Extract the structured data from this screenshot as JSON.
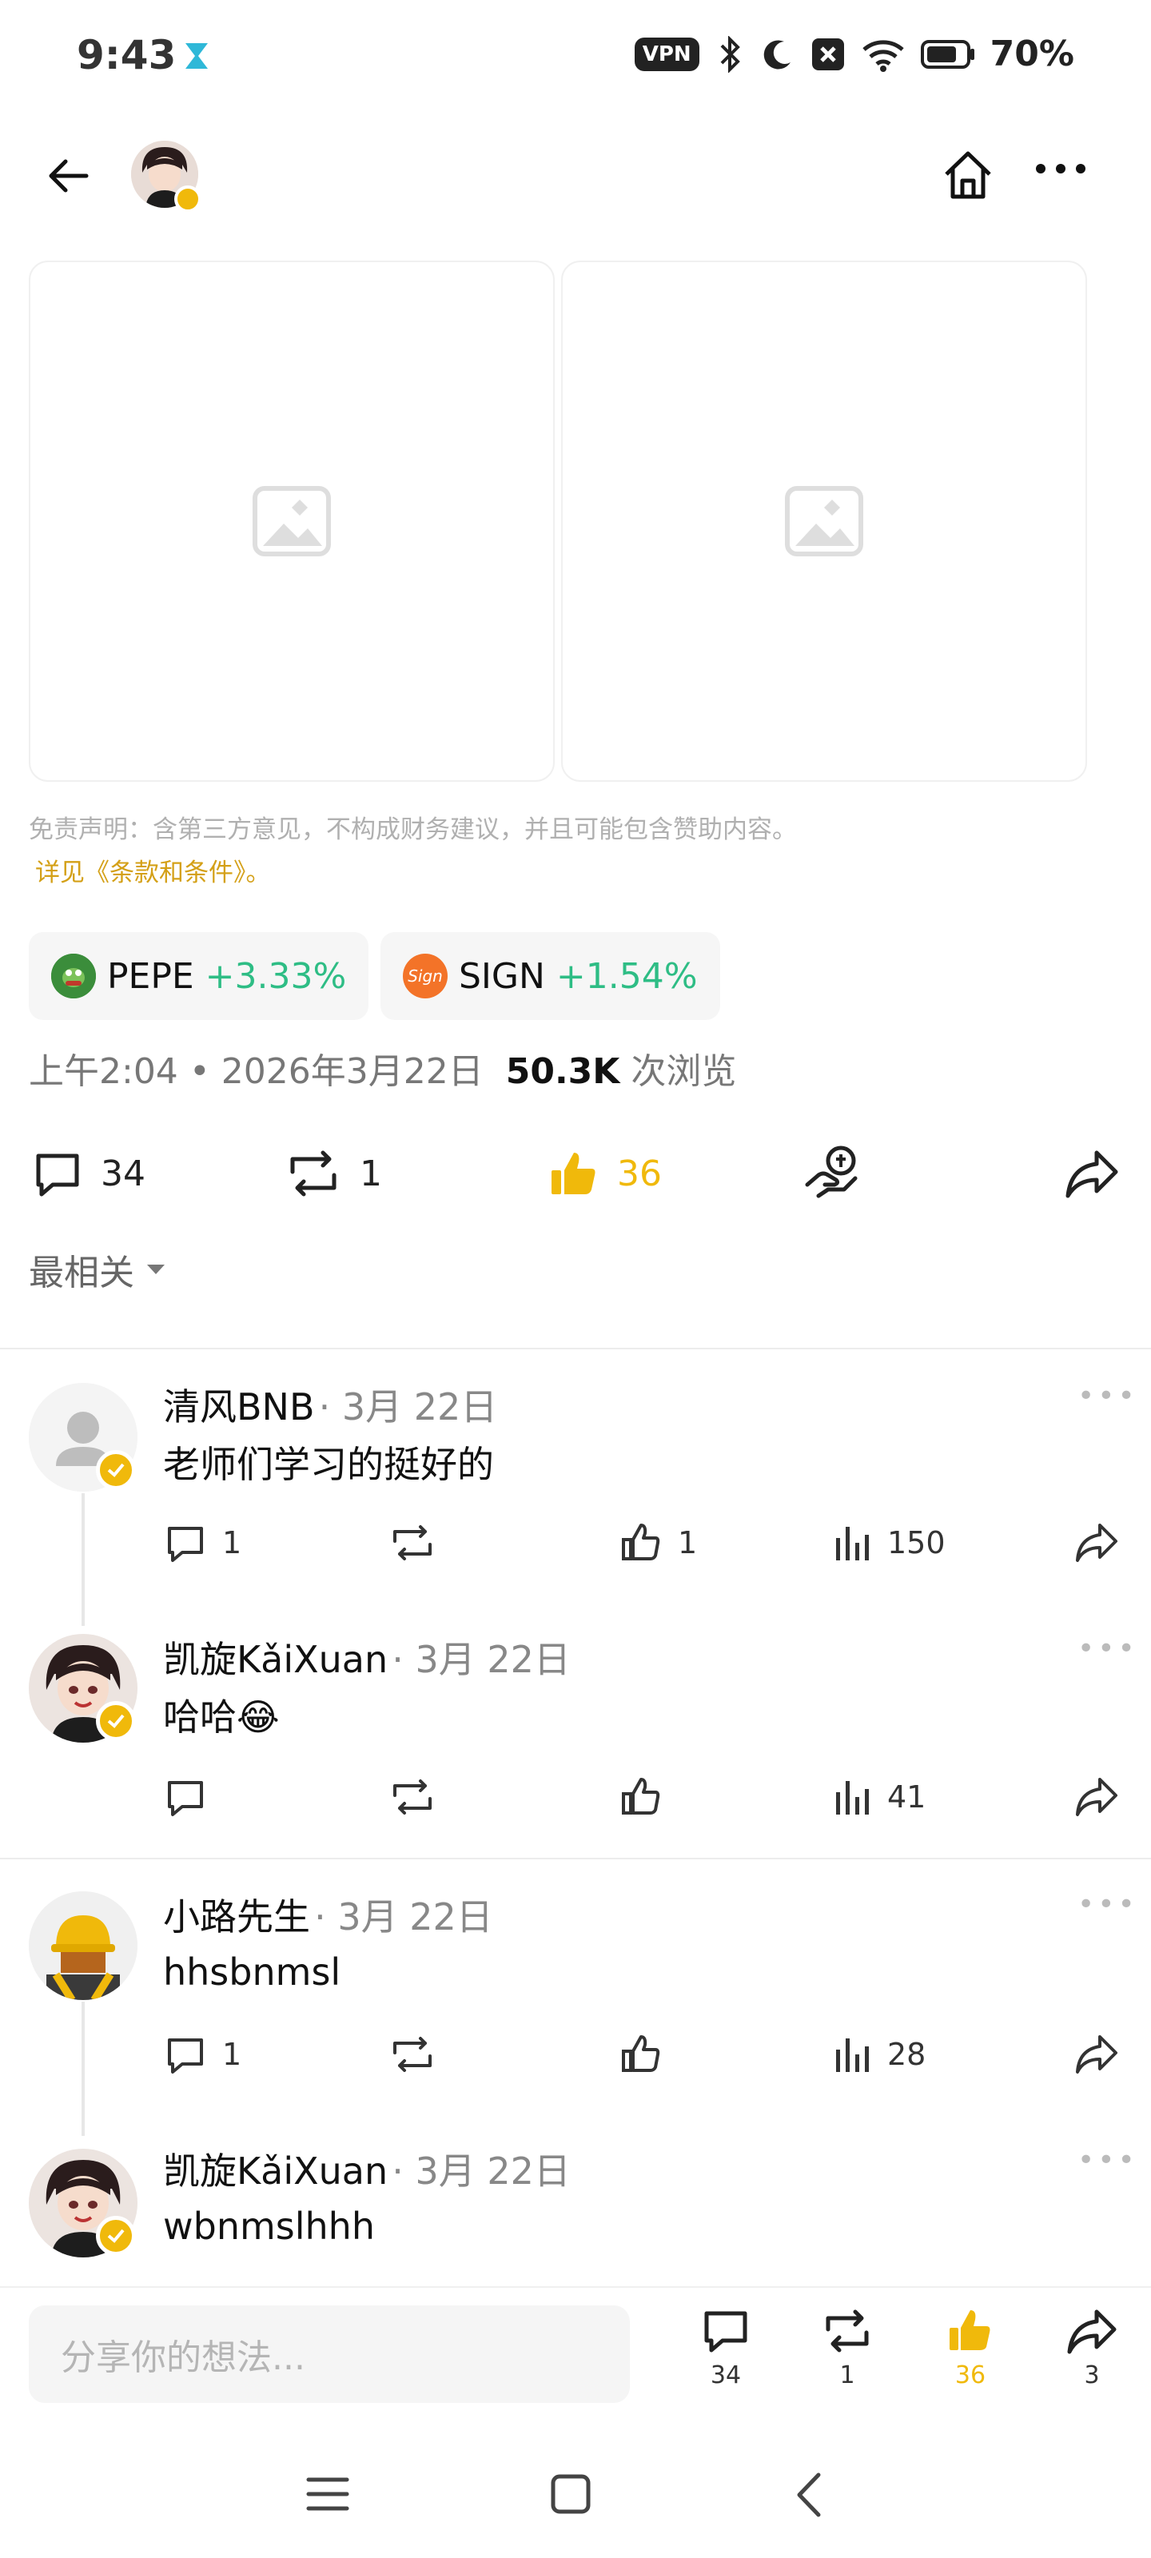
{
  "status_bar": {
    "time": "9:43",
    "vpn": "VPN",
    "battery": "70%"
  },
  "disclaimer": {
    "text": "免责声明：含第三方意见，不构成财务建议，并且可能包含赞助内容。",
    "terms_link": "详见《条款和条件》。"
  },
  "tickers": [
    {
      "symbol": "PEPE",
      "change": "+3.33%"
    },
    {
      "symbol": "SIGN",
      "change": "+1.54%"
    }
  ],
  "post_meta": {
    "time": "上午2:04",
    "separator": "•",
    "date": "2026年3月22日",
    "views": "50.3K",
    "views_label": "次浏览"
  },
  "post_actions": {
    "comments": "34",
    "reposts": "1",
    "likes": "36"
  },
  "sort": {
    "label": "最相关"
  },
  "comments": [
    {
      "name": "清风BNB",
      "date": "· 3月 22日",
      "text": "老师们学习的挺好的",
      "replies": "1",
      "reposts": "",
      "likes": "1",
      "views": "150"
    },
    {
      "name": "凯旋KǎiXuan",
      "date": "· 3月 22日",
      "text": "哈哈😂",
      "replies": "",
      "reposts": "",
      "likes": "",
      "views": "41"
    },
    {
      "name": "小路先生",
      "date": "· 3月 22日",
      "text": "hhsbnmsl",
      "replies": "1",
      "reposts": "",
      "likes": "",
      "views": "28"
    },
    {
      "name": "凯旋KǎiXuan",
      "date": "· 3月 22日",
      "text": "wbnmslhhh"
    }
  ],
  "reply_input": {
    "placeholder": "分享你的想法..."
  },
  "bottom_actions": {
    "comments": "34",
    "reposts": "1",
    "likes": "36",
    "shares": "3"
  },
  "colors": {
    "accent": "#f0b90b",
    "positive": "#2ebd85",
    "muted": "#888888"
  }
}
